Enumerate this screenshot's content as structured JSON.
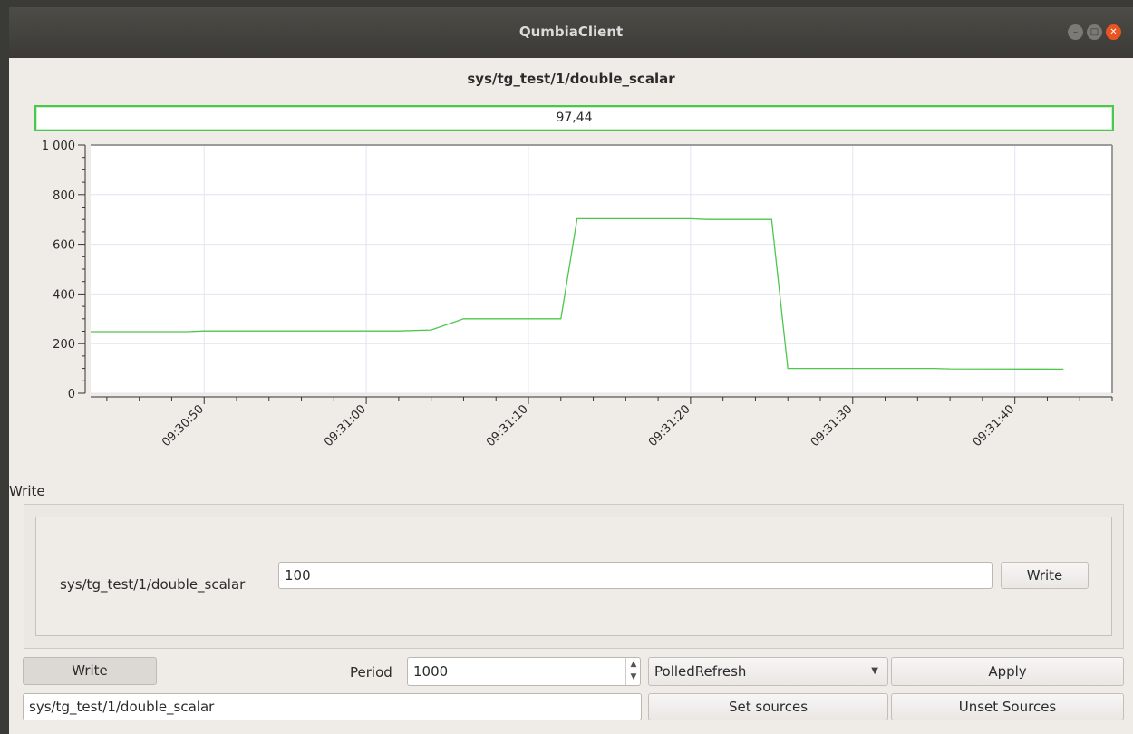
{
  "window": {
    "title": "QumbiaClient"
  },
  "window_buttons": {
    "minimize": "–",
    "maximize": "□",
    "close": "✕"
  },
  "reader": {
    "source_title": "sys/tg_test/1/double_scalar",
    "value": "97,44"
  },
  "chart_data": {
    "type": "line",
    "title": "",
    "xlabel": "",
    "ylabel": "",
    "ylim": [
      0,
      1000
    ],
    "yticks": [
      0,
      200,
      400,
      600,
      800,
      1000
    ],
    "ytick_labels": [
      "0",
      "200",
      "400",
      "600",
      "800",
      "1 000"
    ],
    "xlim": [
      "09:30:43",
      "09:31:46"
    ],
    "xticks": [
      "09:30:50",
      "09:31:00",
      "09:31:10",
      "09:31:20",
      "09:31:30",
      "09:31:40"
    ],
    "grid": true,
    "series": [
      {
        "color": "#4cc74c",
        "x": [
          "09:30:43",
          "09:30:49",
          "09:30:50",
          "09:31:00",
          "09:31:02",
          "09:31:04",
          "09:31:06",
          "09:31:08",
          "09:31:12",
          "09:31:13",
          "09:31:20",
          "09:31:21",
          "09:31:24",
          "09:31:25",
          "09:31:26",
          "09:31:35",
          "09:31:36",
          "09:31:43"
        ],
        "y": [
          248,
          248,
          251,
          251,
          251,
          255,
          300,
          300,
          300,
          703,
          703,
          700,
          700,
          700,
          100,
          100,
          98,
          97
        ]
      }
    ]
  },
  "write_section": {
    "label": "Write",
    "source_label": "sys/tg_test/1/double_scalar",
    "input_value": "100",
    "write_button": "Write"
  },
  "controls": {
    "write_toggle": "Write",
    "period_label": "Period",
    "period_value": "1000",
    "spin_up": "▲",
    "spin_down": "▼",
    "refresh_mode": "PolledRefresh",
    "combo_arrow": "▼",
    "apply_button": "Apply",
    "sources_value": "sys/tg_test/1/double_scalar",
    "set_sources_button": "Set sources",
    "unset_sources_button": "Unset Sources"
  }
}
